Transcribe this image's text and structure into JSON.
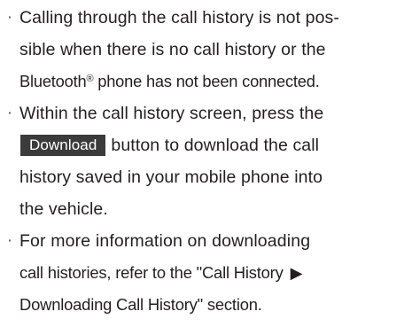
{
  "notes": [
    {
      "bullet": "·",
      "line1": "Calling through the call history is not pos-",
      "line2": "sible when there is no call history or the",
      "line3_pre": "Bluetooth",
      "line3_sup": "®",
      "line3_post": " phone has not been connected."
    },
    {
      "bullet": "·",
      "line1": "Within the call history screen, press the",
      "button_label": "Download",
      "line2_post": "button to download the call",
      "line3": "history saved in your mobile phone into",
      "line4": "the vehicle."
    },
    {
      "bullet": "·",
      "line1": "For more information on downloading",
      "line2_pre": "call histories, refer to the \"Call History",
      "arrow_icon": "right-triangle-icon",
      "arrow_glyph": "▶",
      "line3": "Downloading Call History\" section."
    }
  ]
}
